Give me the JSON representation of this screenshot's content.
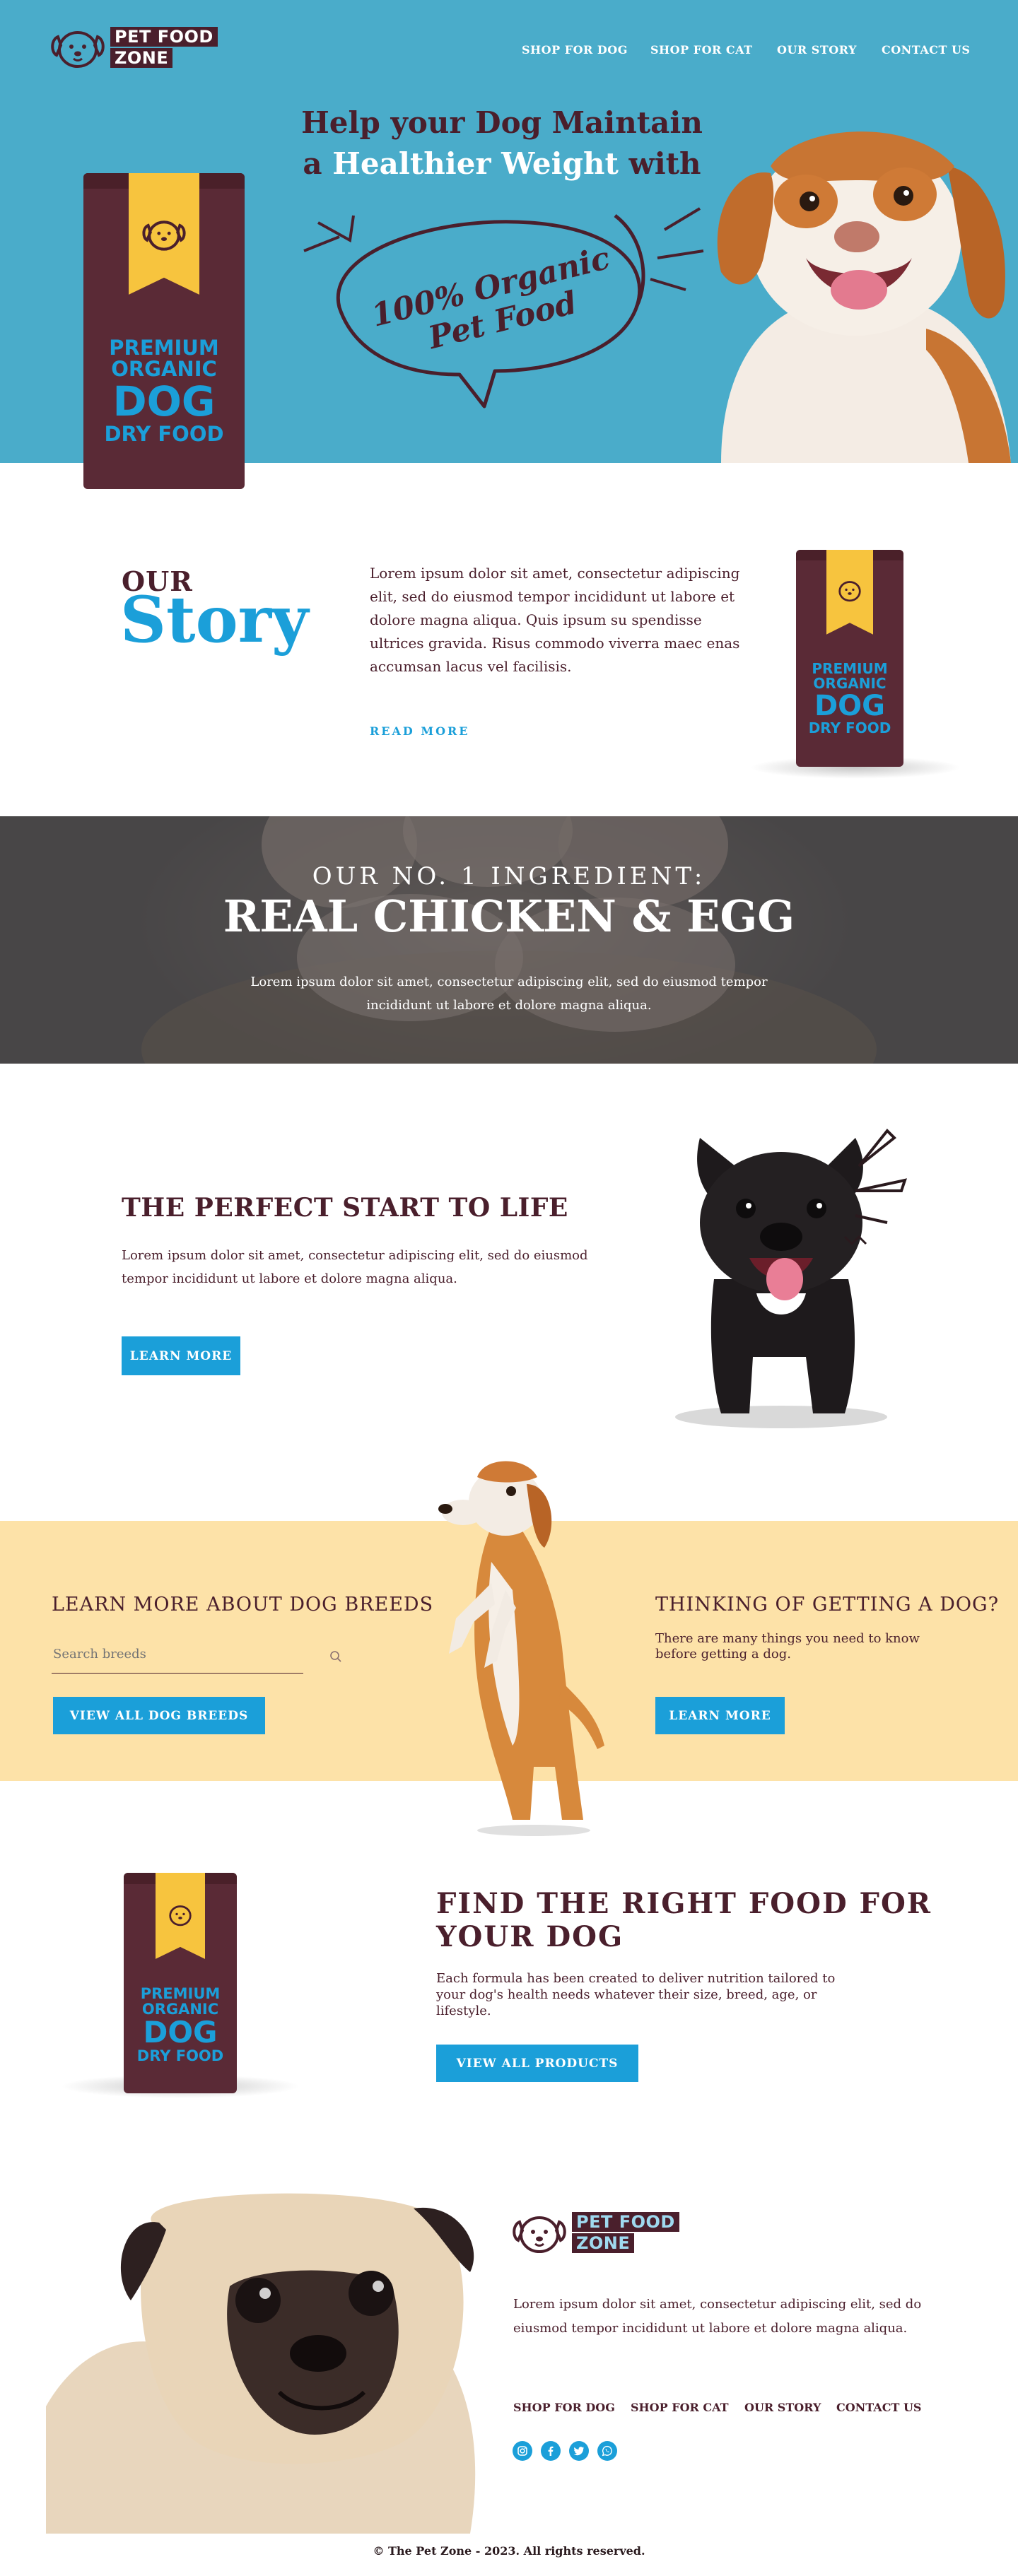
{
  "brand": {
    "logo_line1": "PET FOOD",
    "logo_line2": "ZONE"
  },
  "nav": {
    "items": [
      "SHOP FOR DOG",
      "SHOP FOR CAT",
      "OUR STORY",
      "CONTACT US"
    ]
  },
  "hero": {
    "title_line1": "Help your Dog Maintain",
    "title_line2a": "a ",
    "title_line2b": "Healthier Weight",
    "title_line2c": " with",
    "bubble_line1": "100% Organic",
    "bubble_line2": "Pet Food"
  },
  "bag": {
    "line1": "PREMIUM",
    "line2": "ORGANIC",
    "line3": "DOG",
    "line4": "DRY FOOD"
  },
  "story": {
    "our": "OUR",
    "heading": "Story",
    "body": "Lorem ipsum dolor sit amet, consectetur adipiscing elit, sed do eiusmod tempor    incididunt ut labore et dolore magna aliqua. Quis ipsum su spendisse ultrices gravida. Risus commodo viverra maec  enas accumsan lacus vel facilisis.",
    "read_more": "READ MORE"
  },
  "ingredient": {
    "subtitle": "OUR NO. 1 INGREDIENT:",
    "title": "REAL CHICKEN & EGG",
    "body": "Lorem ipsum dolor sit amet, consectetur adipiscing elit, sed do eiusmod tempor incididunt ut labore et dolore magna aliqua."
  },
  "perfect_start": {
    "title": "THE PERFECT START TO LIFE",
    "body": "Lorem ipsum dolor sit amet, consectetur adipiscing elit, sed do eiusmod tempor incididunt ut labore et dolore magna aliqua.",
    "button": "LEARN MORE"
  },
  "breeds": {
    "title": "LEARN MORE ABOUT DOG BREEDS",
    "search_placeholder": "Search breeds",
    "button": "VIEW ALL DOG BREEDS"
  },
  "getting_dog": {
    "title": "THINKING OF GETTING A DOG?",
    "body": "There are many things you need to know before getting a dog.",
    "button": "LEARN MORE"
  },
  "find_food": {
    "title_line1": "FIND THE RIGHT FOOD FOR",
    "title_line2": "YOUR DOG",
    "body": "Each formula has been created to deliver nutrition tailored to your dog's health needs whatever their size, breed, age, or lifestyle.",
    "button": "VIEW ALL PRODUCTS"
  },
  "footer": {
    "body": "Lorem ipsum dolor sit amet, consectetur adipiscing elit, sed do eiusmod tempor incididunt ut labore et dolore magna aliqua.",
    "nav": [
      "SHOP FOR DOG",
      "SHOP FOR CAT",
      "OUR STORY",
      "CONTACT US"
    ],
    "social": [
      "instagram-icon",
      "facebook-icon",
      "twitter-icon",
      "whatsapp-icon"
    ],
    "copyright": "© The Pet Zone - 2023. All rights reserved."
  },
  "colors": {
    "hero_bg": "#4aacca",
    "brand_dark": "#4a1f2c",
    "accent_blue": "#1b9fd9",
    "bag": "#5a2a36",
    "ribbon": "#f7c43e",
    "cream": "#fde2a8"
  }
}
